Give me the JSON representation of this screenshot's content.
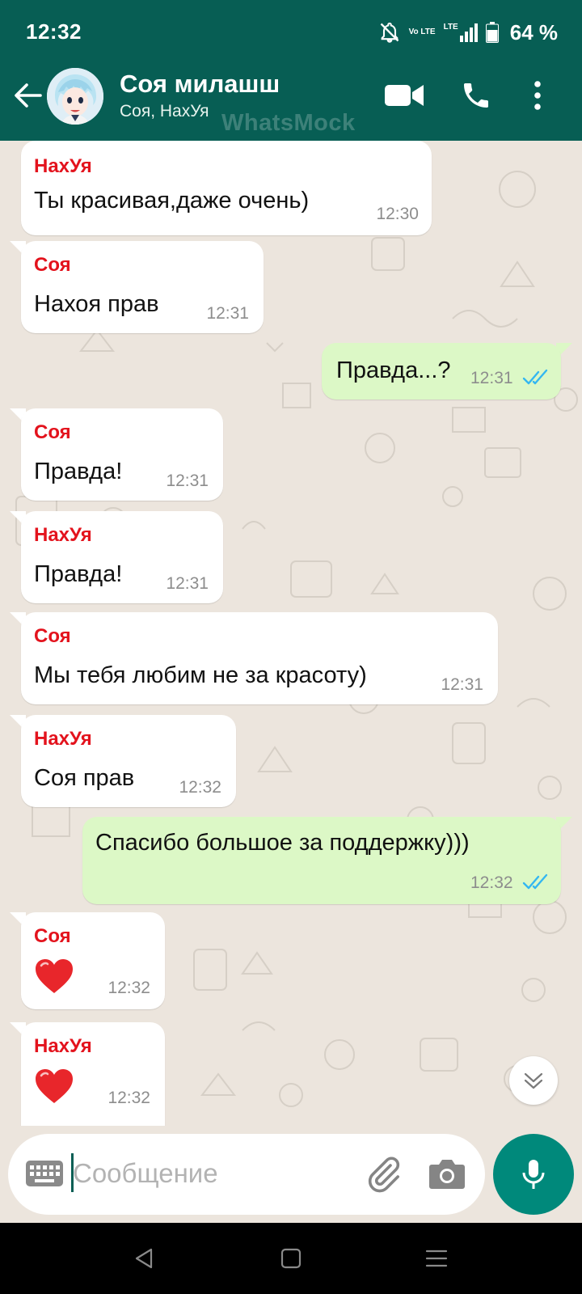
{
  "status": {
    "time": "12:32",
    "volte_label": "Vo LTE",
    "lte_label": "LTE",
    "battery": "64 %"
  },
  "header": {
    "contact_name": "Соя милашш",
    "members": "Соя, НахУя",
    "watermark": "WhatsMock"
  },
  "messages": [
    {
      "direction": "in",
      "sender": "НахУя",
      "text": "Ты красивая,даже очень)",
      "time": "12:30"
    },
    {
      "direction": "in",
      "sender": "Соя",
      "text": "Нахоя прав",
      "time": "12:31"
    },
    {
      "direction": "out",
      "text": "Правда...?",
      "time": "12:31",
      "status": "read"
    },
    {
      "direction": "in",
      "sender": "Соя",
      "text": "Правда!",
      "time": "12:31"
    },
    {
      "direction": "in",
      "sender": "НахУя",
      "text": "Правда!",
      "time": "12:31"
    },
    {
      "direction": "in",
      "sender": "Соя",
      "text": "Мы тебя любим не за красоту)",
      "time": "12:31"
    },
    {
      "direction": "in",
      "sender": "НахУя",
      "text": "Соя прав",
      "time": "12:32"
    },
    {
      "direction": "out",
      "text": "Спасибо большое за поддержку)))",
      "time": "12:32",
      "status": "read"
    },
    {
      "direction": "in",
      "sender": "Соя",
      "emoji": "heart",
      "time": "12:32"
    },
    {
      "direction": "in",
      "sender": "НахУя",
      "emoji": "heart",
      "time": "12:32"
    }
  ],
  "composer": {
    "placeholder": "Сообщение"
  },
  "colors": {
    "header": "#075e54",
    "sender_name": "#e3131d",
    "outgoing_bubble": "#dcf8c6",
    "read_ticks": "#34b7f1",
    "mic_button": "#00897b"
  }
}
